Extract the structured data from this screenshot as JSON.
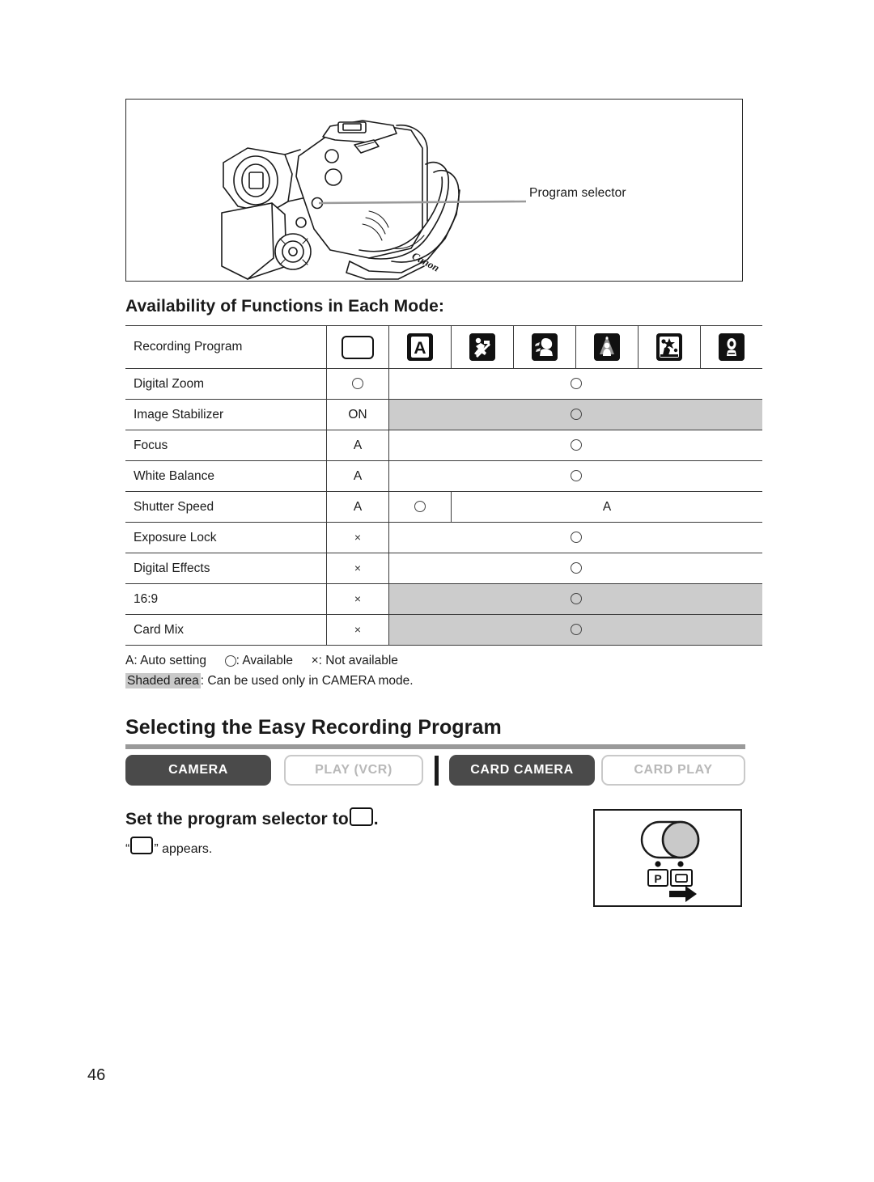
{
  "page": {
    "number": "46"
  },
  "illustration": {
    "name": "camcorder-line-drawing",
    "callout_label": "Program selector",
    "brand_mark": "Canon"
  },
  "availability": {
    "heading": "Availability of Functions in Each Mode:",
    "columns": [
      {
        "key": "label",
        "icon": ""
      },
      {
        "key": "easy-recording",
        "icon": "blank-rectangle-icon"
      },
      {
        "key": "auto",
        "icon": "auto-A-icon"
      },
      {
        "key": "sports",
        "icon": "sports-icon"
      },
      {
        "key": "portrait",
        "icon": "portrait-icon"
      },
      {
        "key": "spotlight",
        "icon": "spotlight-icon"
      },
      {
        "key": "sand-and-snow",
        "icon": "sand-and-snow-icon"
      },
      {
        "key": "low-light",
        "icon": "low-light-icon"
      }
    ],
    "rows": [
      {
        "label": "Recording Program",
        "type": "header"
      },
      {
        "label": "Digital Zoom",
        "easy": "circle",
        "rest": "circle",
        "shaded": false
      },
      {
        "label": "Image Stabilizer",
        "easy": "ON",
        "rest": "circle",
        "shaded": true
      },
      {
        "label": "Focus",
        "easy": "A",
        "rest": "circle",
        "shaded": false
      },
      {
        "label": "White Balance",
        "easy": "A",
        "rest": "circle",
        "shaded": false
      },
      {
        "label": "Shutter Speed",
        "easy": "A",
        "auto": "circle",
        "rest": "A",
        "shaded": false,
        "split": true
      },
      {
        "label": "Exposure Lock",
        "easy": "×",
        "rest": "circle",
        "shaded": false
      },
      {
        "label": "Digital Effects",
        "easy": "×",
        "rest": "circle",
        "shaded": false
      },
      {
        "label": "16:9",
        "easy": "×",
        "rest": "circle",
        "shaded": true
      },
      {
        "label": "Card Mix",
        "easy": "×",
        "rest": "circle",
        "shaded": true
      }
    ],
    "legend": {
      "auto": "A: Auto setting",
      "available": ": Available",
      "not_available": "×: Not available",
      "shaded_tag": "Shaded area",
      "shaded_text": ": Can be used only in CAMERA mode."
    }
  },
  "section": {
    "title": "Selecting the Easy Recording Program"
  },
  "modes": [
    {
      "label": "CAMERA",
      "active": true
    },
    {
      "label": "PLAY (VCR)",
      "active": false
    },
    {
      "label": "CARD CAMERA",
      "active": true
    },
    {
      "label": "CARD PLAY",
      "active": false
    }
  ],
  "step": {
    "heading_before": "Set the program selector to",
    "heading_after": ".",
    "sub_before": "“",
    "sub_after": "” appears."
  },
  "selector_diagram": {
    "name": "program-selector-switch",
    "position_p_label": "P",
    "position_easy_label": "blank-rectangle",
    "arrow": "right-arrow"
  },
  "colors": {
    "rule": "#9a9a9a",
    "badge_active_bg": "#4a4a4a",
    "badge_inactive_border": "#c9c9c9",
    "shaded_cell": "#cccccc",
    "table_line": "#3a3a3a"
  }
}
